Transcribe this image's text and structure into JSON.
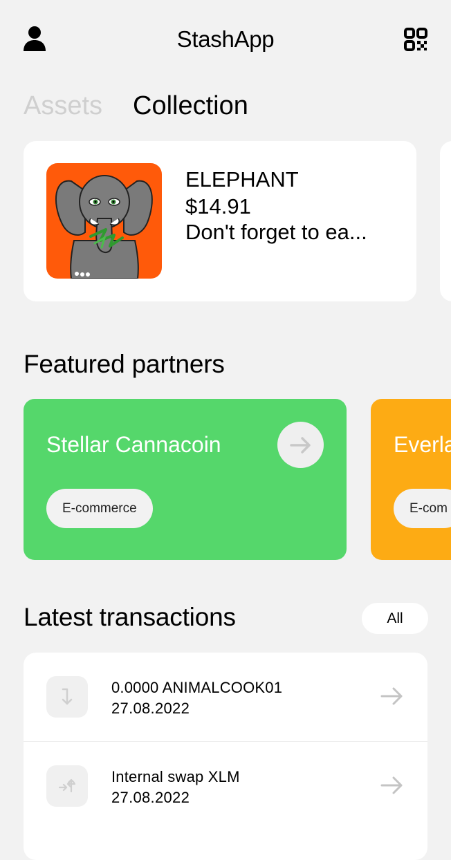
{
  "header": {
    "title": "StashApp",
    "left_icon": "user-icon",
    "right_icon": "qr-code-icon"
  },
  "tabs": [
    {
      "label": "Assets",
      "active": false
    },
    {
      "label": "Collection",
      "active": true
    }
  ],
  "collection": {
    "items": [
      {
        "name": "ELEPHANT",
        "price": "$14.91",
        "description": "Don't forget to ea...",
        "image": "elephant-nft-image"
      }
    ]
  },
  "featured": {
    "title": "Featured partners",
    "partners": [
      {
        "name": "Stellar Cannacoin",
        "tag": "E-commerce",
        "color": "#55d76b"
      },
      {
        "name": "Everla",
        "tag": "E-com",
        "color": "#fdab14"
      }
    ]
  },
  "transactions": {
    "title": "Latest transactions",
    "all_label": "All",
    "items": [
      {
        "name": "0.0000 ANIMALCOOK01",
        "date": "27.08.2022",
        "icon": "receive-icon"
      },
      {
        "name": "Internal swap XLM",
        "date": "27.08.2022",
        "icon": "swap-icon"
      }
    ]
  },
  "colors": {
    "background": "#f2f2f2",
    "card": "#ffffff",
    "inactive_tab": "#cfcfcf",
    "nft_background": "#ff5a0a"
  }
}
